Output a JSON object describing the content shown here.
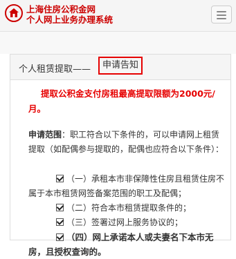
{
  "header": {
    "title_line1": "上海住房公积金网",
    "title_line2": "个人网上业务办理系统",
    "logo_icon": "housing-fund-logo-icon",
    "menu_icon": "hamburger-menu-icon"
  },
  "panel": {
    "title_prefix": "个人租赁提取——",
    "title_highlight": "申请告知",
    "notice": "提取公积金支付房租最高提取限额为2000元/月。",
    "scope_label": "申请范围",
    "scope_text": "：职工符合以下条件的，可以申请网上租赁提取（如配偶参与提取的，配偶也应符合以下条件）：",
    "conditions": [
      "（一）承租本市非保障性住房且租赁住房不属于本市租赁网签备案范围的职工及配偶；",
      "（二）符合本市租赁提取条件的；",
      "（三）签署过网上服务协议的；",
      "（四）网上承诺本人或夫妻名下本市无房，且授权查询的。"
    ]
  },
  "colors": {
    "brand_red": "#cc0000",
    "highlight_border": "#e60000"
  }
}
